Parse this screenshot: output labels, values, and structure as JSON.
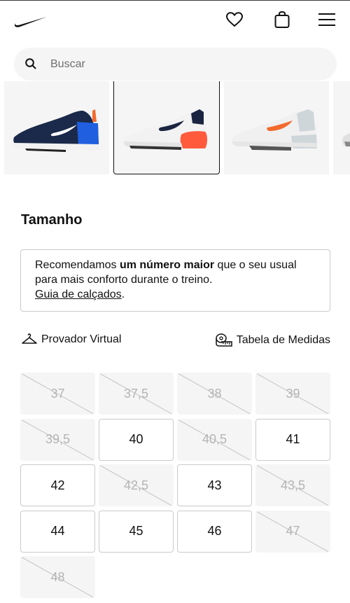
{
  "header": {
    "logo_icon": "nike-swoosh-icon",
    "icons": [
      "heart-icon",
      "bag-icon",
      "menu-icon"
    ]
  },
  "search": {
    "placeholder": "Buscar",
    "icon": "search-icon"
  },
  "gallery": {
    "selected_index": 1,
    "thumbnails": [
      {
        "colors": {
          "upper": "#1b2a4a",
          "accent": "#1f5fe0",
          "sole": "#ffffff"
        }
      },
      {
        "colors": {
          "upper": "#f2f2f2",
          "accent": "#ff5a3c",
          "sole": "#e8e8e8"
        }
      },
      {
        "colors": {
          "upper": "#f0f0f0",
          "accent": "#f26b2d",
          "sole": "#cfd6da"
        }
      },
      {
        "colors": {
          "upper": "#e0e0e0",
          "accent": "#888888",
          "sole": "#ffffff"
        }
      }
    ]
  },
  "sizes_section": {
    "title": "Tamanho",
    "notice": {
      "prefix": "Recomendamos ",
      "bold": "um número maior",
      "suffix": " que o seu usual",
      "line2": "para mais conforto durante o treino.",
      "link": "Guia de calçados",
      "after_link": "."
    },
    "virtual_fitting": {
      "label": "Provador Virtual",
      "icon": "hanger-icon"
    },
    "size_chart": {
      "label": "Tabela de Medidas",
      "icon": "measuring-tape-icon"
    },
    "sizes": [
      {
        "label": "37",
        "available": false
      },
      {
        "label": "37,5",
        "available": false
      },
      {
        "label": "38",
        "available": false
      },
      {
        "label": "39",
        "available": false
      },
      {
        "label": "39,5",
        "available": false
      },
      {
        "label": "40",
        "available": true
      },
      {
        "label": "40,5",
        "available": false
      },
      {
        "label": "41",
        "available": true
      },
      {
        "label": "42",
        "available": true
      },
      {
        "label": "42,5",
        "available": false
      },
      {
        "label": "43",
        "available": true
      },
      {
        "label": "43,5",
        "available": false
      },
      {
        "label": "44",
        "available": true
      },
      {
        "label": "45",
        "available": true
      },
      {
        "label": "46",
        "available": true
      },
      {
        "label": "47",
        "available": false
      },
      {
        "label": "48",
        "available": false
      }
    ]
  }
}
